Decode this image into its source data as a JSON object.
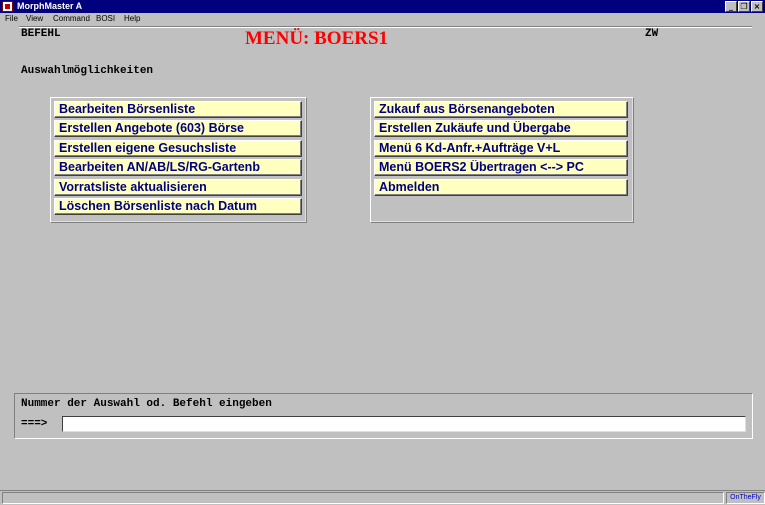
{
  "window": {
    "title": "MorphMaster A",
    "controls": {
      "minimize": "_",
      "restore": "❐",
      "close": "×"
    }
  },
  "menubar": {
    "items": [
      "File",
      "View",
      "Command",
      "BOSI",
      "Help"
    ]
  },
  "screen": {
    "befehl_label": "BEFEHL",
    "menu_title": "MENÜ: BOERS1",
    "zw_label": "ZW",
    "section_heading": "Auswahlmöglichkeiten",
    "left_options": [
      "Bearbeiten Börsenliste",
      "Erstellen Angebote (603) Börse",
      "Erstellen eigene Gesuchsliste",
      "Bearbeiten AN/AB/LS/RG-Gartenb",
      "Vorratsliste aktualisieren",
      "Löschen Börsenliste nach Datum"
    ],
    "right_options": [
      "Zukauf aus Börsenangeboten",
      "Erstellen Zukäufe und Übergabe",
      "Menü 6 Kd-Anfr.+Aufträge V+L",
      "Menü BOERS2 Übertragen <--> PC",
      "Abmelden"
    ],
    "command_prompt": "Nummer der Auswahl od. Befehl eingeben",
    "input_arrow": "===>",
    "input_value": ""
  },
  "statusbar": {
    "indicator": "OnTheFly"
  },
  "colors": {
    "titlebar": "#00007f",
    "menu_title": "#ff0000",
    "button_bg": "#ffffc0",
    "button_text": "#000080",
    "background": "#c0c0c0"
  }
}
